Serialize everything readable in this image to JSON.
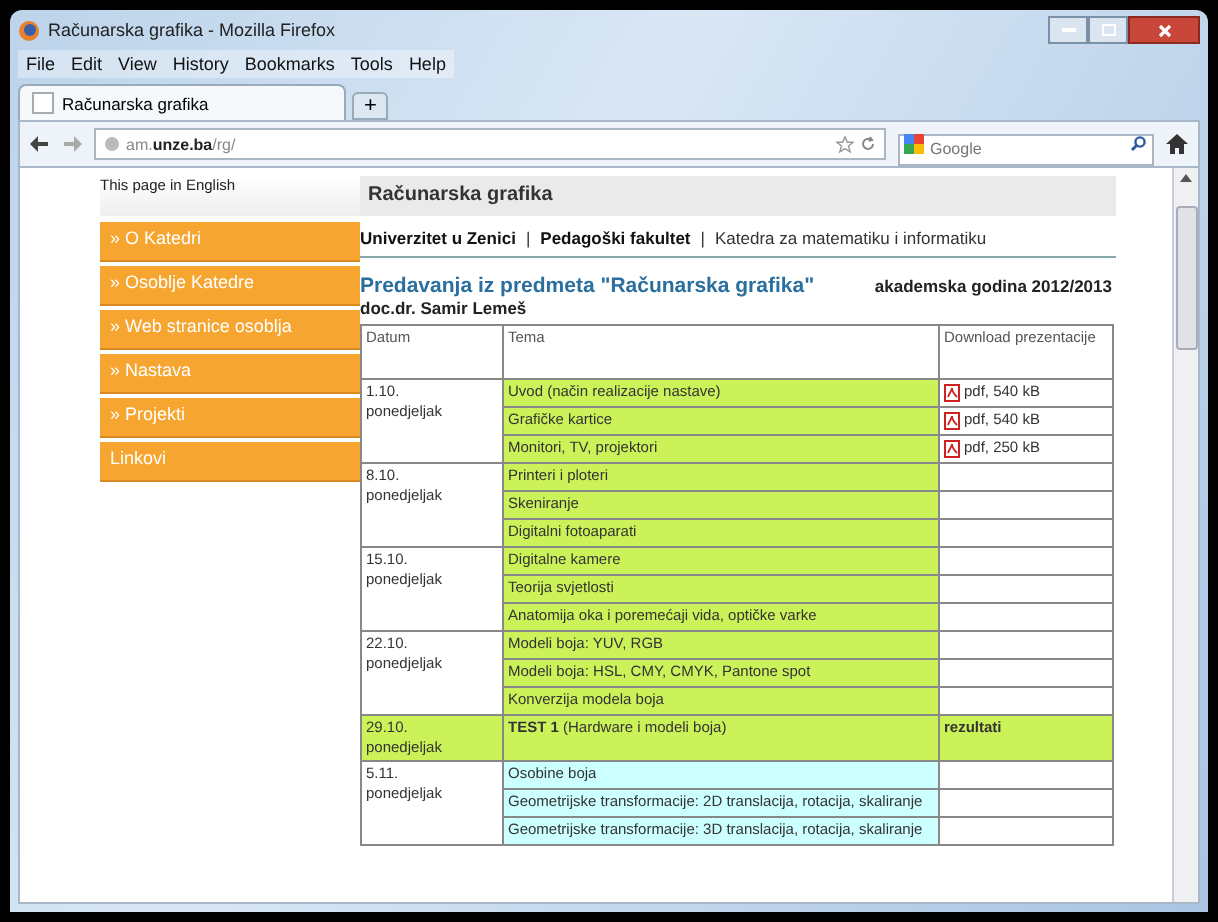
{
  "window": {
    "title": "Računarska grafika - Mozilla Firefox"
  },
  "menu": [
    "File",
    "Edit",
    "View",
    "History",
    "Bookmarks",
    "Tools",
    "Help"
  ],
  "tabs": [
    {
      "label": "Računarska grafika",
      "selected": true
    }
  ],
  "new_tab": "+",
  "address_bar": {
    "value": "am.**unze.ba**/rg/"
  },
  "search": {
    "placeholder": "Google"
  },
  "page": {
    "english_link": "This page in English",
    "header": "Računarska grafika",
    "sidebar": [
      {
        "label": "» O Katedri"
      },
      {
        "label": "» Osoblje Katedre"
      },
      {
        "label": "» Web stranice osoblja"
      },
      {
        "label": "» Nastava"
      },
      {
        "label": "» Projekti"
      },
      {
        "label": "Linkovi"
      }
    ],
    "breadcrumb": [
      {
        "label": "Univerzitet u Zenici",
        "bold": true
      },
      {
        "label": "Pedagoški fakultet",
        "bold": true
      },
      {
        "label": "Katedra za matematiku i informatiku",
        "bold": false
      }
    ],
    "breadcrumb_separator": "|",
    "heading": "Predavanja iz predmeta \"Računarska grafika\"",
    "year": "akademska godina 2012/2013",
    "lecturer": "doc.dr. Samir Lemeš",
    "table": {
      "columns": [
        "Datum",
        "Tema",
        "Download prezentacije"
      ],
      "groups": [
        {
          "date": "1.10.",
          "day": "ponedjeljak",
          "topics": [
            {
              "title": "Uvod (način realizacije nastave)",
              "color": "#ccf25a",
              "download": {
                "kind": "pdf",
                "text": "pdf, 540 kB"
              }
            },
            {
              "title": "Grafičke kartice",
              "color": "#ccf25a",
              "download": {
                "kind": "pdf",
                "text": "pdf, 540 kB"
              }
            },
            {
              "title": "Monitori, TV, projektori",
              "color": "#ccf25a",
              "download": {
                "kind": "pdf",
                "text": "pdf, 250 kB"
              }
            }
          ]
        },
        {
          "date": "8.10.",
          "day": "ponedjeljak",
          "topics": [
            {
              "title": "Printeri i ploteri",
              "color": "#ccf25a"
            },
            {
              "title": "Skeniranje",
              "color": "#ccf25a"
            },
            {
              "title": "Digitalni fotoaparati",
              "color": "#ccf25a"
            }
          ]
        },
        {
          "date": "15.10.",
          "day": "ponedjeljak",
          "topics": [
            {
              "title": "Digitalne kamere",
              "color": "#ccf25a"
            },
            {
              "title": "Teorija svjetlosti",
              "color": "#ccf25a"
            },
            {
              "title": "Anatomija oka i poremećaji vida, optičke varke",
              "color": "#ccf25a"
            }
          ]
        },
        {
          "date": "22.10.",
          "day": "ponedjeljak",
          "topics": [
            {
              "title": "Modeli boja: YUV, RGB",
              "color": "#ccf25a"
            },
            {
              "title": "Modeli boja: HSL, CMY, CMYK, Pantone spot",
              "color": "#ccf25a"
            },
            {
              "title": "Konverzija modela boja",
              "color": "#ccf25a"
            }
          ]
        },
        {
          "date": "29.10.",
          "day": "ponedjeljak",
          "color": "#ccf25a",
          "topics": [
            {
              "title": "**TEST 1** (Hardware i modeli boja)",
              "color": "#ccf25a",
              "download": {
                "kind": "text",
                "text": "rezultati",
                "color": "#ccf25a"
              }
            }
          ]
        },
        {
          "date": "5.11.",
          "day": "ponedjeljak",
          "topics": [
            {
              "title": "Osobine boja",
              "color": "#ccffff"
            },
            {
              "title": "Geometrijske transformacije: 2D translacija, rotacija, skaliranje",
              "color": "#ccffff"
            },
            {
              "title": "Geometrijske transformacije: 3D translacija, rotacija, skaliranje",
              "color": "#ccffff"
            }
          ]
        }
      ]
    }
  }
}
